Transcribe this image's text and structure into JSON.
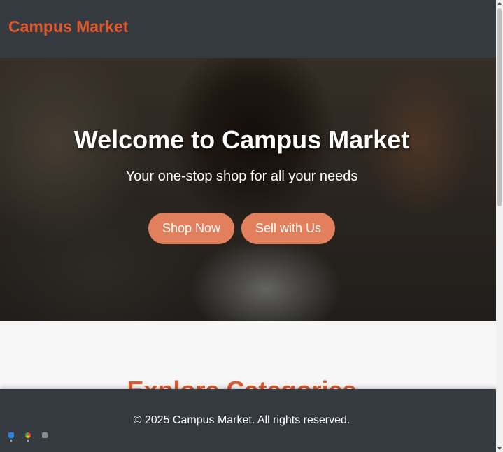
{
  "header": {
    "brand": "Campus Market"
  },
  "hero": {
    "title": "Welcome to Campus Market",
    "subtitle": "Your one-stop shop for all your needs",
    "buttons": {
      "shop": "Shop Now",
      "sell": "Sell with Us"
    }
  },
  "categories": {
    "title": "Explore Categories"
  },
  "footer": {
    "copyright": "© 2025 Campus Market. All rights reserved."
  },
  "tray": {
    "icons": [
      "app-icon",
      "chrome-icon",
      "window-icon"
    ]
  },
  "colors": {
    "accent": "#e0582b",
    "button": "#e2805e",
    "header_bg": "#343a40"
  },
  "scrollbar": {
    "position": 0.0
  }
}
